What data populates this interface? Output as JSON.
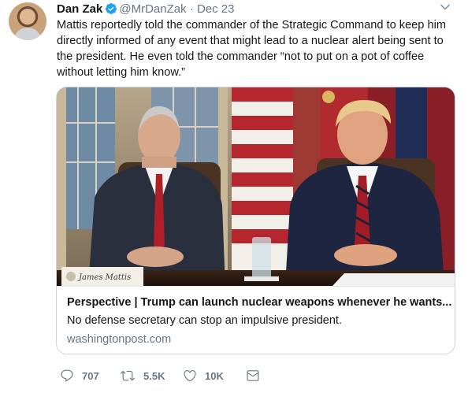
{
  "tweet": {
    "author_name": "Dan Zak",
    "handle": "@MrDanZak",
    "separator": "·",
    "date": "Dec 23",
    "text": "Mattis reportedly told the commander of the Strategic Command to keep him directly informed of any event that might lead to a nuclear alert being sent to the president. He even told the commander “not to put on a pot of coffee without letting him know.”"
  },
  "card": {
    "title": "Perspective | Trump can launch nuclear weapons whenever he wants...",
    "description": "No defense secretary can stop an impulsive president.",
    "domain": "washingtonpost.com",
    "nameplate": "James Mattis"
  },
  "actions": {
    "replies": "707",
    "retweets": "5.5K",
    "likes": "10K"
  },
  "icons": {
    "verified": "verified-badge-icon",
    "caret": "chevron-down-icon",
    "reply": "reply-icon",
    "retweet": "retweet-icon",
    "like": "heart-icon",
    "message": "direct-message-icon"
  },
  "colors": {
    "verified": "#1da1f2",
    "icon_gray": "#657786",
    "text": "#14171a",
    "border": "#ccd6dd"
  }
}
